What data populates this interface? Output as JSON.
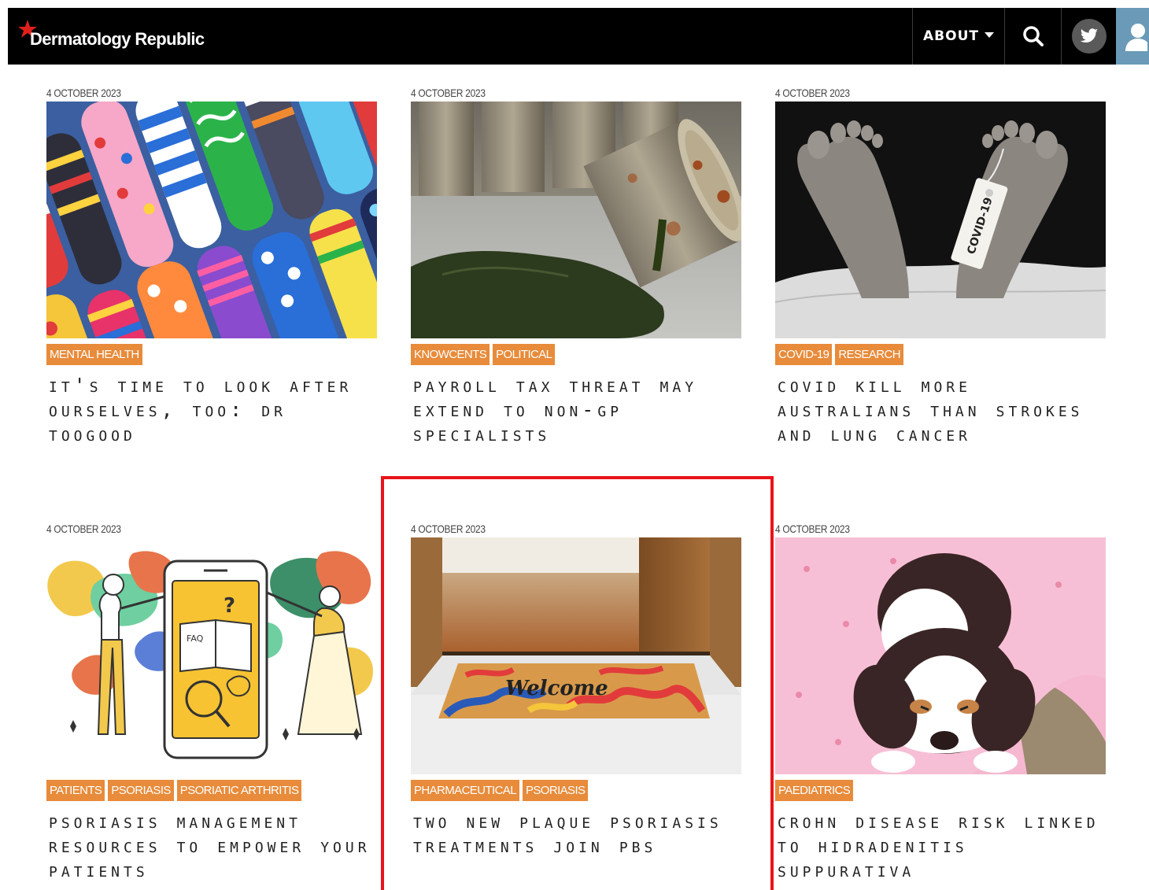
{
  "header": {
    "logo_text": "Dermatology Republic",
    "nav_about": "ABOUT",
    "icons": [
      "search-icon",
      "twitter-icon",
      "user-icon"
    ],
    "colors": {
      "bar": "#000000",
      "user_button": "#6a9ab7",
      "logo_star": "#e0201b"
    }
  },
  "articles": [
    {
      "date": "4 OCTOBER 2023",
      "tags": [
        "MENTAL HEALTH"
      ],
      "title": "It's time to look after ourselves, too: Dr Toogood",
      "image": "colorful-socks"
    },
    {
      "date": "4 OCTOBER 2023",
      "tags": [
        "KNOWCENTS",
        "POLITICAL"
      ],
      "title": "Payroll tax threat may extend to non-GP specialists",
      "image": "toxic-barrel-spill"
    },
    {
      "date": "4 OCTOBER 2023",
      "tags": [
        "COVID-19",
        "RESEARCH"
      ],
      "title": "Covid kill more Australians than strokes and lung cancer",
      "image": "feet-with-toe-tag"
    },
    {
      "date": "4 OCTOBER 2023",
      "tags": [
        "PATIENTS",
        "PSORIASIS",
        "PSORIATIC ARTHRITIS"
      ],
      "title": "Psoriasis management resources to empower your patients",
      "image": "faq-illustration"
    },
    {
      "date": "4 OCTOBER 2023",
      "tags": [
        "PHARMACEUTICAL",
        "PSORIASIS"
      ],
      "title": "Two new plaque psoriasis treatments join PBS",
      "image": "welcome-doormat"
    },
    {
      "date": "4 OCTOBER 2023",
      "tags": [
        "PAEDIATRICS"
      ],
      "title": "Crohn disease risk linked to hidradenitis suppurativa",
      "image": "puppy-on-blanket"
    }
  ],
  "tag_color": "#e88b3a",
  "highlight_color": "#e8141a"
}
